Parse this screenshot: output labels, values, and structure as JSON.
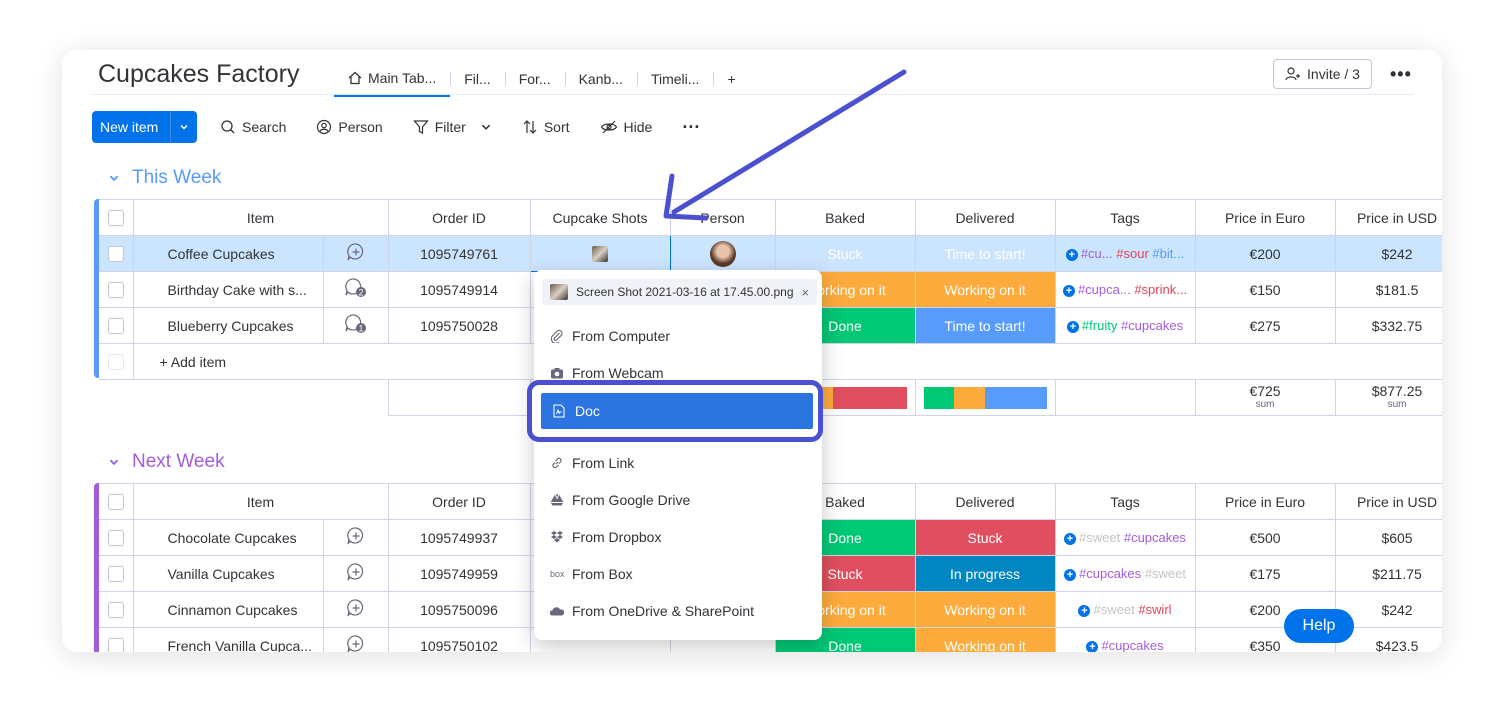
{
  "board": {
    "title": "Cupcakes Factory",
    "tabs": [
      {
        "label": "Main Tab...",
        "active": true
      },
      {
        "label": "Fil..."
      },
      {
        "label": "For..."
      },
      {
        "label": "Kanb..."
      },
      {
        "label": "Timeli..."
      }
    ],
    "add_tab": "+",
    "invite_label": "Invite / 3",
    "more": "•••"
  },
  "toolbar": {
    "new_item": "New item",
    "search": "Search",
    "person": "Person",
    "filter": "Filter",
    "sort": "Sort",
    "hide": "Hide",
    "more": "···"
  },
  "columns": [
    "Item",
    "Order ID",
    "Cupcake Shots",
    "Person",
    "Baked",
    "Delivered",
    "Tags",
    "Price in Euro",
    "Price in USD"
  ],
  "groups": [
    {
      "title": "This Week",
      "color": "#579bfc",
      "rows": [
        {
          "item": "Coffee Cupcakes",
          "updates": "",
          "order": "1095749761",
          "baked": "Stuck",
          "delivered": "Time to start!",
          "tags": [
            "#cu...",
            "#sour",
            "#bit..."
          ],
          "euro": "€200",
          "usd": "$242"
        },
        {
          "item": "Birthday Cake with s...",
          "updates": "2",
          "order": "1095749914",
          "baked": "Working on it",
          "delivered": "Working on it",
          "tags": [
            "#cupca...",
            "#sprink..."
          ],
          "euro": "€150",
          "usd": "$181.5"
        },
        {
          "item": "Blueberry Cupcakes",
          "updates": "1",
          "order": "1095750028",
          "baked": "Done",
          "delivered": "Time to start!",
          "tags": [
            "#fruity",
            "#cupcakes"
          ],
          "euro": "€275",
          "usd": "$332.75"
        }
      ],
      "add_item": "+ Add item",
      "sum_euro": "€725",
      "sum_usd": "$877.25",
      "sum_label": "sum"
    },
    {
      "title": "Next Week",
      "color": "#a25ddc",
      "rows": [
        {
          "item": "Chocolate Cupcakes",
          "order": "1095749937",
          "baked": "Done",
          "delivered": "Stuck",
          "tags": [
            "#sweet",
            "#cupcakes"
          ],
          "euro": "€500",
          "usd": "$605"
        },
        {
          "item": "Vanilla Cupcakes",
          "order": "1095749959",
          "baked": "Stuck",
          "delivered": "In progress",
          "tags": [
            "#cupcakes",
            "#sweet"
          ],
          "euro": "€175",
          "usd": "$211.75"
        },
        {
          "item": "Cinnamon Cupcakes",
          "order": "1095750096",
          "baked": "Working on it",
          "delivered": "Working on it",
          "tags": [
            "#sweet",
            "#swirl"
          ],
          "euro": "€200",
          "usd": "$242"
        },
        {
          "item": "French Vanilla Cupca...",
          "order": "1095750102",
          "baked": "Done",
          "delivered": "Working on it",
          "tags": [
            "#cupcakes"
          ],
          "euro": "€350",
          "usd": "$423.5"
        }
      ]
    }
  ],
  "popup": {
    "file_name": "Screen Shot 2021-03-16 at 17.45.00.png",
    "items": [
      "From Computer",
      "From Webcam",
      "Doc",
      "From Link",
      "From Google Drive",
      "From Dropbox",
      "From Box",
      "From OneDrive & SharePoint"
    ]
  },
  "help": "Help",
  "colors": {
    "accent": "#0073ea",
    "stuck": "#df4f5f",
    "working": "#fdab3d",
    "done": "#00c875",
    "time_to_start": "#579bfc",
    "in_progress": "#0086c0",
    "annotation": "#4a50d0"
  }
}
